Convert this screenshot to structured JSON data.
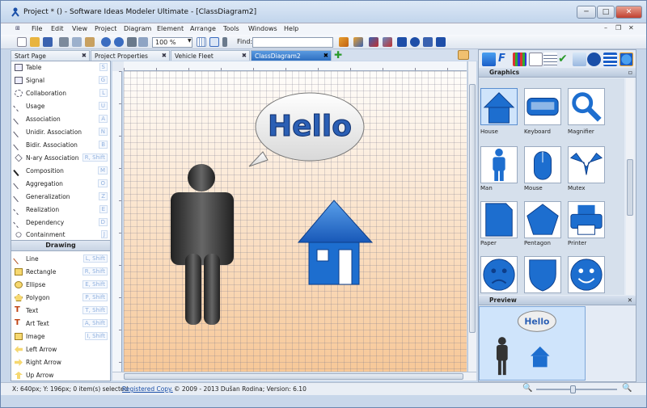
{
  "window": {
    "title": "Project * () - Software Ideas Modeler Ultimate - [ClassDiagram2]",
    "minimize": "─",
    "maximize": "□",
    "close": "✕"
  },
  "menu": {
    "items": [
      "File",
      "Edit",
      "View",
      "Project",
      "Diagram",
      "Element",
      "Arrange",
      "Tools",
      "Windows",
      "Help"
    ],
    "mdi_min": "–",
    "mdi_restore": "❐",
    "mdi_close": "✕"
  },
  "toolbar": {
    "zoom": "100 %",
    "find_label": "Find:",
    "find_value": ""
  },
  "tabs": [
    "Start Page",
    "Project Properties",
    "Vehicle Fleet",
    "ClassDiagram2"
  ],
  "left_panel": {
    "items": [
      {
        "label": "Table",
        "shortcut": "S"
      },
      {
        "label": "Signal",
        "shortcut": "G"
      },
      {
        "label": "Collaboration",
        "shortcut": "L"
      },
      {
        "label": "Usage",
        "shortcut": "U"
      },
      {
        "label": "Association",
        "shortcut": "A"
      },
      {
        "label": "Unidir. Association",
        "shortcut": "N"
      },
      {
        "label": "Bidir. Association",
        "shortcut": "B"
      },
      {
        "label": "N-ary Association",
        "shortcut": "R, Shift"
      },
      {
        "label": "Composition",
        "shortcut": "M"
      },
      {
        "label": "Aggregation",
        "shortcut": "O"
      },
      {
        "label": "Generalization",
        "shortcut": "Z"
      },
      {
        "label": "Realization",
        "shortcut": "E"
      },
      {
        "label": "Dependency",
        "shortcut": "D"
      },
      {
        "label": "Containment",
        "shortcut": "J"
      }
    ],
    "drawing_header": "Drawing",
    "drawing_items": [
      {
        "label": "Line",
        "shortcut": "L, Shift"
      },
      {
        "label": "Rectangle",
        "shortcut": "R, Shift"
      },
      {
        "label": "Ellipse",
        "shortcut": "E, Shift"
      },
      {
        "label": "Polygon",
        "shortcut": "P, Shift"
      },
      {
        "label": "Text",
        "shortcut": "T, Shift"
      },
      {
        "label": "Art Text",
        "shortcut": "A, Shift"
      },
      {
        "label": "Image",
        "shortcut": "I, Shift"
      },
      {
        "label": "Left Arrow",
        "shortcut": ""
      },
      {
        "label": "Right Arrow",
        "shortcut": ""
      },
      {
        "label": "Up Arrow",
        "shortcut": ""
      }
    ]
  },
  "canvas": {
    "bubble_text": "Hello"
  },
  "graphics_panel": {
    "title": "Graphics",
    "items": [
      "House",
      "Keyboard",
      "Magnifier",
      "Man",
      "Mouse",
      "Mutex",
      "Paper",
      "Pentagon",
      "Printer",
      "",
      "",
      ""
    ]
  },
  "preview_panel": {
    "title": "Preview",
    "bubble_text": "Hello"
  },
  "status": {
    "coords": "X: 640px; Y: 196px; 0 item(s) selected",
    "registered": "Registered Copy.",
    "copyright": "© 2009 - 2013 Dušan Rodina; Version: 6.10"
  },
  "colors": {
    "accent": "#2e6fc0",
    "shape_blue": "#1d6ecf"
  }
}
